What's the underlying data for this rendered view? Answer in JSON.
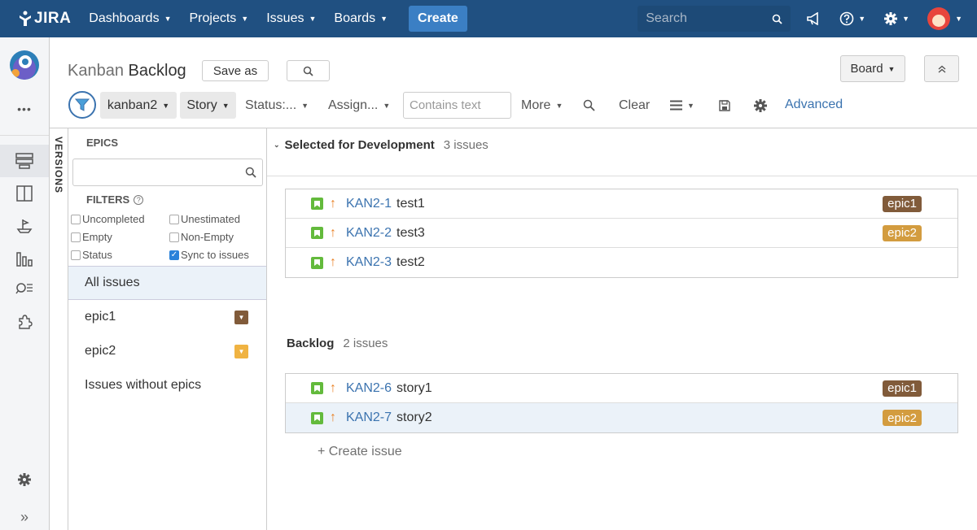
{
  "colors": {
    "nav_bg": "#205081",
    "create_btn": "#3b7fc4",
    "link": "#3b73af",
    "epic1": "#815b3a",
    "epic2": "#d39c3f",
    "story": "#63ba3c",
    "priority": "#e98125"
  },
  "topnav": {
    "logo": "JIRA",
    "menu": [
      {
        "label": "Dashboards"
      },
      {
        "label": "Projects"
      },
      {
        "label": "Issues"
      },
      {
        "label": "Boards"
      }
    ],
    "create_label": "Create",
    "search_placeholder": "Search",
    "icons": [
      "megaphone-icon",
      "help-icon",
      "gear-icon",
      "user-avatar"
    ]
  },
  "sidebar": {
    "icons": [
      "project-avatar",
      "more-icon",
      "backlog-icon",
      "board-icon",
      "releases-icon",
      "reports-icon",
      "issues-search-icon",
      "addons-icon",
      "settings-icon",
      "expand-icon"
    ],
    "more_label": "•••",
    "expand_label": "»"
  },
  "header": {
    "title_prefix": "Kanban",
    "title": "Backlog",
    "save_as": "Save as",
    "board_label": "Board"
  },
  "filterbar": {
    "board_pill": "kanban2",
    "type_pill": "Story",
    "status": "Status:...",
    "assignee": "Assign...",
    "contains_placeholder": "Contains text",
    "more": "More",
    "clear": "Clear",
    "advanced": "Advanced"
  },
  "versions_label": "VERSIONS",
  "epics": {
    "heading": "EPICS",
    "filters_heading": "FILTERS",
    "filters": {
      "uncompleted": {
        "label": "Uncompleted",
        "checked": false
      },
      "unestimated": {
        "label": "Unestimated",
        "checked": false
      },
      "empty": {
        "label": "Empty",
        "checked": false
      },
      "non_empty": {
        "label": "Non-Empty",
        "checked": false
      },
      "status": {
        "label": "Status",
        "checked": false
      },
      "sync": {
        "label": "Sync to issues",
        "checked": true
      }
    },
    "list": {
      "all": "All issues",
      "epic1": "epic1",
      "epic2": "epic2",
      "none": "Issues without epics"
    }
  },
  "selected_for_dev": {
    "title": "Selected for Development",
    "count": "3 issues",
    "issues": [
      {
        "key": "KAN2-1",
        "summary": "test1",
        "epic": "epic1"
      },
      {
        "key": "KAN2-2",
        "summary": "test3",
        "epic": "epic2"
      },
      {
        "key": "KAN2-3",
        "summary": "test2",
        "epic": ""
      }
    ]
  },
  "backlog": {
    "title": "Backlog",
    "count": "2 issues",
    "issues": [
      {
        "key": "KAN2-6",
        "summary": "story1",
        "epic": "epic1"
      },
      {
        "key": "KAN2-7",
        "summary": "story2",
        "epic": "epic2"
      }
    ],
    "create_issue": "+  Create issue"
  }
}
